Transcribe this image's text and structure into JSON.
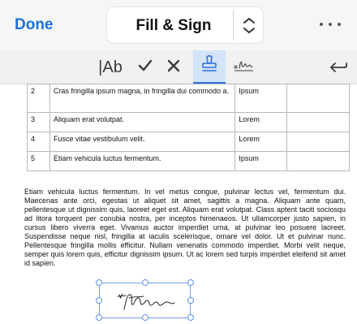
{
  "header": {
    "done_label": "Done",
    "mode_label": "Fill & Sign"
  },
  "toolbar": {
    "text_tool_label": "|Ab",
    "active_tool": "stamp",
    "accent_color": "#2f6fd8"
  },
  "table": {
    "rows": [
      {
        "num": "2",
        "text": "Cras fringilla ipsum magna, in fringilla dui commodo a.",
        "value": "Ipsum",
        "extra": ""
      },
      {
        "num": "3",
        "text": "Aliquam erat volutpat.",
        "value": "Lorem",
        "extra": ""
      },
      {
        "num": "4",
        "text": "Fusce vitae vestibulum velit.",
        "value": "Lorem",
        "extra": ""
      },
      {
        "num": "5",
        "text": "Etiam vehicula luctus fermentum.",
        "value": "Ipsum",
        "extra": ""
      }
    ]
  },
  "body": {
    "paragraph": "Etiam vehicula luctus fermentum. In vel metus congue, pulvinar lectus vel, fermentum dui. Maecenas ante orci, egestas ut aliquet sit amet, sagittis a magna. Aliquam ante quam, pellentesque ut dignissim quis, laoreet eget est. Aliquam erat volutpat. Class aptent taciti sociosqu ad litora torquent per conubia nostra, per inceptos himenaeos. Ut ullamcorper justo sapien, in cursus libero viverra eget. Vivamus auctor imperdiet urna, at pulvinar leo posuere laoreet. Suspendisse neque nisl, fringilla at iaculis scelerisque, ornare vel dolor. Ut et pulvinar nunc. Pellentesque fringilla mollis efficitur. Nullam venenatis commodo imperdiet. Morbi velit neque, semper quis lorem quis, efficitur dignissim ipsum. Ut ac lorem sed turpis imperdiet eleifend sit amet id sapien."
  },
  "icons": {
    "mode_switch": "chevron-up-down-icon",
    "more": "ellipsis-icon",
    "check": "checkmark-icon",
    "cross": "cross-icon",
    "stamp": "stamp-icon",
    "sign": "signature-icon",
    "back": "undo-arrow-icon"
  }
}
